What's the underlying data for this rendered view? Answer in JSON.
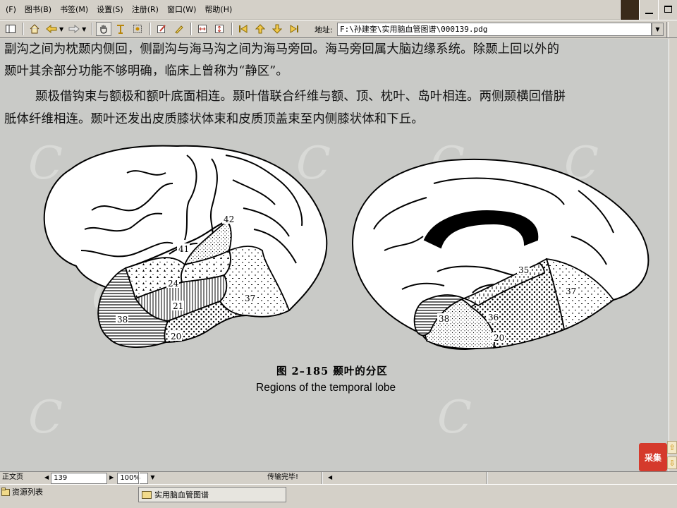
{
  "menu": {
    "items": [
      "(F)",
      "图书(B)",
      "书签(M)",
      "设置(S)",
      "注册(R)",
      "窗口(W)",
      "帮助(H)"
    ]
  },
  "toolbar": {
    "address_label": "地址:",
    "address_value": "F:\\孙建奎\\实用脑血管图谱\\000139.pdg",
    "icons": [
      "toggle-panel-icon",
      "home-icon",
      "back-arrow-icon",
      "forward-arrow-icon",
      "hand-tool-icon",
      "text-select-icon",
      "region-select-icon",
      "annotate-icon",
      "highlight-icon",
      "fit-width-icon",
      "fit-page-icon",
      "first-page-icon",
      "prev-page-icon",
      "next-page-icon",
      "last-page-icon"
    ]
  },
  "document": {
    "paragraph_lines": [
      "副沟之间为枕颞内侧回，侧副沟与海马沟之间为海马旁回。海马旁回属大脑边缘系统。除颞上回以外的",
      "颞叶其余部分功能不够明确，临床上曾称为“静区”。",
      "颞极借钩束与额极和额叶底面相连。颞叶借联合纤维与额、顶、枕叶、岛叶相连。两侧颞横回借胼",
      "胝体纤维相连。颞叶还发出皮质膝状体束和皮质顶盖束至内侧膝状体和下丘。"
    ],
    "figure": {
      "caption_cn": "图 2–185    颞叶的分区",
      "caption_en": "Regions of the temporal lobe",
      "lateral_labels": [
        "42",
        "41",
        "24",
        "21",
        "38",
        "20",
        "37"
      ],
      "medial_labels": [
        "35",
        "37",
        "36",
        "38",
        "20"
      ]
    },
    "logo_text": "采集"
  },
  "statusbar": {
    "mode": "正文页",
    "page": "139",
    "zoom": "100%",
    "status": "传输完毕!"
  },
  "taskbar": {
    "resource_tab": "资源列表",
    "window_title": "实用脑血管图谱"
  },
  "colors": {
    "chrome": "#d4d0c8",
    "page_background": "#c9cac7",
    "accent": "#0a246a"
  }
}
